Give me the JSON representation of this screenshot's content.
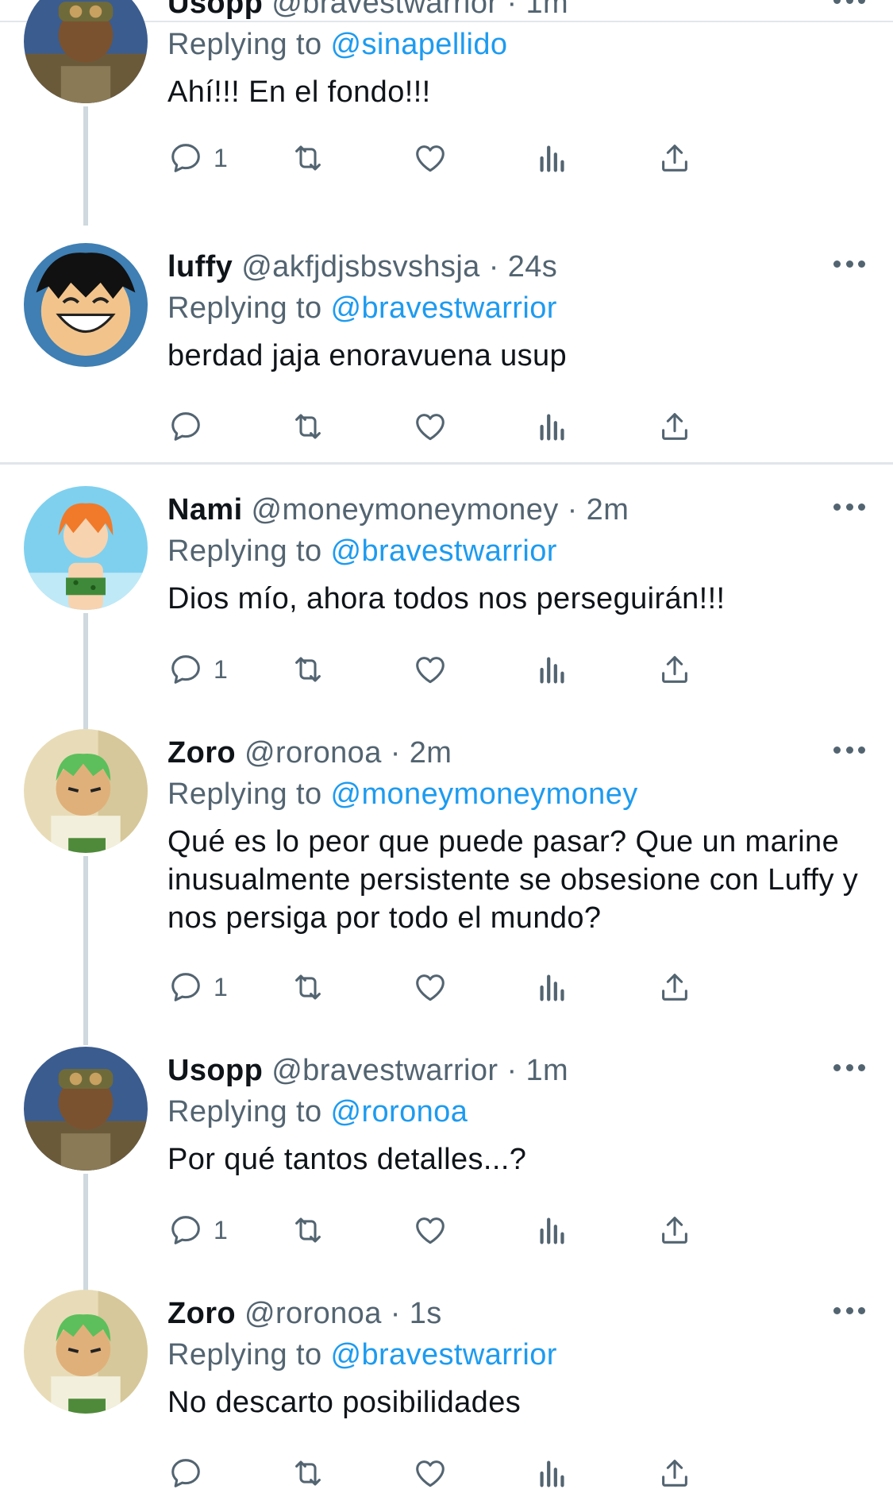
{
  "tweets": [
    {
      "name": "Usopp",
      "handle": "@bravestwarrior",
      "time": "1m",
      "replying_label": "Replying to",
      "replying_to": "@sinapellido",
      "text": "Ahí!!! En el fondo!!!",
      "reply_count": "1",
      "avatar": "usopp"
    },
    {
      "name": "luffy",
      "handle": "@akfjdjsbsvshsja",
      "time": "24s",
      "replying_label": "Replying to",
      "replying_to": "@bravestwarrior",
      "text": "berdad jaja enoravuena usup",
      "reply_count": "",
      "avatar": "luffy"
    },
    {
      "name": "Nami",
      "handle": "@moneymoneymoney",
      "time": "2m",
      "replying_label": "Replying to",
      "replying_to": "@bravestwarrior",
      "text": "Dios mío, ahora todos nos perseguirán!!!",
      "reply_count": "1",
      "avatar": "nami"
    },
    {
      "name": "Zoro",
      "handle": "@roronoa",
      "time": "2m",
      "replying_label": "Replying to",
      "replying_to": "@moneymoneymoney",
      "text": "Qué es lo peor que puede pasar? Que un marine inusualmente persistente se obsesione con Luffy y nos persiga por todo el mundo?",
      "reply_count": "1",
      "avatar": "zoro"
    },
    {
      "name": "Usopp",
      "handle": "@bravestwarrior",
      "time": "1m",
      "replying_label": "Replying to",
      "replying_to": "@roronoa",
      "text": "Por qué tantos detalles...?",
      "reply_count": "1",
      "avatar": "usopp"
    },
    {
      "name": "Zoro",
      "handle": "@roronoa",
      "time": "1s",
      "replying_label": "Replying to",
      "replying_to": "@bravestwarrior",
      "text": "No descarto posibilidades",
      "reply_count": "",
      "avatar": "zoro"
    }
  ],
  "icons": {
    "reply": "reply-icon",
    "retweet": "retweet-icon",
    "like": "heart-icon",
    "views": "views-icon",
    "share": "share-icon",
    "more": "more-icon"
  },
  "colors": {
    "link": "#1d9bf0",
    "secondary": "#536471",
    "text": "#0f1419"
  }
}
